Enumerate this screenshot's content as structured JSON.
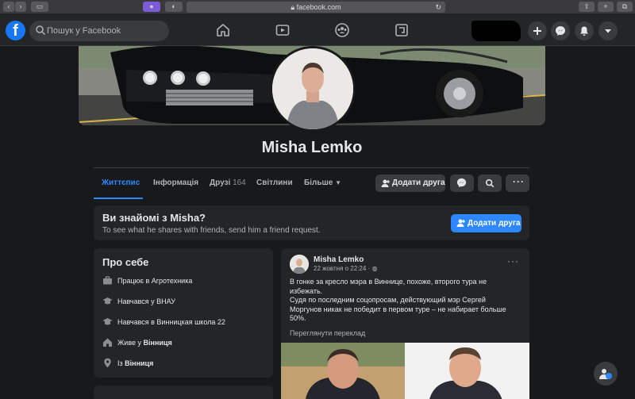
{
  "browser": {
    "url": "facebook.com"
  },
  "nav": {
    "logo": "f",
    "search_placeholder": "Пошук у Facebook"
  },
  "profile": {
    "name": "Misha Lemko"
  },
  "tabs": [
    {
      "label": "Життєпис",
      "active": true
    },
    {
      "label": "Інформація"
    },
    {
      "label": "Друзі",
      "count": "164"
    },
    {
      "label": "Світлини"
    },
    {
      "label": "Більше"
    }
  ],
  "actions": {
    "add_friend": "Додати друга"
  },
  "know": {
    "title": "Ви знайомі з Misha?",
    "subtitle": "To see what he shares with friends, send him a friend request.",
    "button": "Додати друга"
  },
  "about": {
    "title": "Про себе",
    "items": [
      {
        "icon": "work-icon",
        "prefix": "Працює в ",
        "value": "Агротехника"
      },
      {
        "icon": "education-icon",
        "prefix": "Навчався у ",
        "value": "ВНАУ"
      },
      {
        "icon": "education-icon",
        "prefix": "Навчався в ",
        "value": "Винницкая школа 22"
      },
      {
        "icon": "home-icon",
        "prefix": "Живе у ",
        "value": "Вінниця"
      },
      {
        "icon": "location-icon",
        "prefix": "Із ",
        "value": "Вінниця"
      }
    ]
  },
  "post": {
    "author": "Misha Lemko",
    "date": "22 жовтня о 22:24 · ",
    "paragraphs": [
      "В гонке за кресло мэра в Виннице, похоже, второго тура не избежать.",
      "Судя по последним соцопросам, действующий мэр Сергей Моргунов никак не победит в первом туре – не набирает больше 50%."
    ],
    "translate": "Переглянути переклад"
  },
  "colors": {
    "accent": "#2d88ff",
    "background": "#18191a",
    "card": "#242526"
  }
}
